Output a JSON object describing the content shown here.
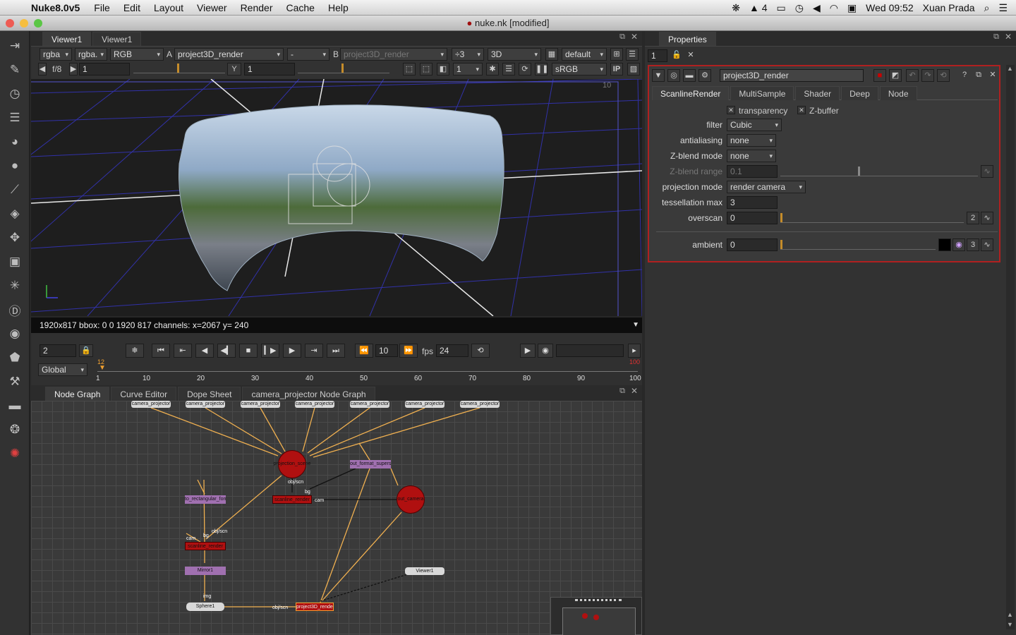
{
  "menubar": {
    "app_name": "Nuke8.0v5",
    "items": [
      "File",
      "Edit",
      "Layout",
      "Viewer",
      "Render",
      "Cache",
      "Help"
    ],
    "status_badge": "4",
    "clock": "Wed 09:52",
    "user": "Xuan Prada"
  },
  "window": {
    "title": "nuke.nk [modified]"
  },
  "viewer": {
    "tabs": [
      "Viewer1",
      "Viewer1"
    ],
    "channels": "rgba",
    "channels_alpha": "rgba.",
    "display": "RGB",
    "a_label": "A",
    "a_input": "project3D_render",
    "wipe": "-",
    "b_label": "B",
    "b_input": "project3D_render",
    "downrez": "÷3",
    "mode": "3D",
    "camera": "default",
    "fstop": "f/8",
    "gain": "1",
    "y_label": "Y",
    "gamma": "1",
    "proxy": "1",
    "lut": "sRGB",
    "ip": "IP",
    "corner_number": "10",
    "info": "1920x817 bbox: 0 0 1920 817 channels:  x=2067 y= 240"
  },
  "playback": {
    "frame": "2",
    "increment": "10",
    "fps_label": "fps",
    "fps": "24",
    "range_mode": "Global",
    "current_frame_marker": "12",
    "end_frame_marker": "100",
    "ticks": [
      "1",
      "10",
      "20",
      "30",
      "40",
      "50",
      "60",
      "70",
      "80",
      "90",
      "100"
    ]
  },
  "nodegraph": {
    "tabs": [
      "Node Graph",
      "Curve Editor",
      "Dope Sheet",
      "camera_projector Node Graph"
    ],
    "camera_nodes": [
      "camera_projector",
      "camera_projector",
      "camera_projector",
      "camera_projector",
      "camera_projector",
      "camera_projector",
      "camera_projector"
    ],
    "nodes": {
      "projection_scene": "projection_scene",
      "format_superscript": "out_format_superscript",
      "rectangular_format": "to_rectangular_format",
      "scanline_render": "scanline_render",
      "scanline_render_2": "scanline_render",
      "out_camera": "out_camera",
      "mirror": "Mirror1",
      "sphere": "Sphere1",
      "viewer": "Viewer1",
      "project3d": "project3D_render"
    },
    "pipe_labels": {
      "obj_scn_1": "obj/scn",
      "obj_scn_2": "obj/scn",
      "obj_scn_3": "obj/scn",
      "cam_1": "cam",
      "cam_2": "cam",
      "bg_1": "bg",
      "bg_2": "bg",
      "img": "img"
    }
  },
  "properties": {
    "title": "Properties",
    "max_panels": "1",
    "node_name": "project3D_render",
    "tabs": [
      "ScanlineRender",
      "MultiSample",
      "Shader",
      "Deep",
      "Node"
    ],
    "transparency_label": "transparency",
    "zbuffer_label": "Z-buffer",
    "filter_label": "filter",
    "filter_value": "Cubic",
    "antialiasing_label": "antialiasing",
    "antialiasing_value": "none",
    "zblend_mode_label": "Z-blend mode",
    "zblend_mode_value": "none",
    "zblend_range_label": "Z-blend range",
    "zblend_range_value": "0.1",
    "projection_mode_label": "projection mode",
    "projection_mode_value": "render camera",
    "tessellation_label": "tessellation max",
    "tessellation_value": "3",
    "overscan_label": "overscan",
    "overscan_value": "0",
    "overscan_dims": "2",
    "ambient_label": "ambient",
    "ambient_value": "0",
    "ambient_channels": "3"
  },
  "colors": {
    "accent_orange": "#f0a030",
    "node_red": "#b01010",
    "node_purple": "#a070b0",
    "grid_blue": "#3a3ac8",
    "props_border": "#b02020"
  }
}
